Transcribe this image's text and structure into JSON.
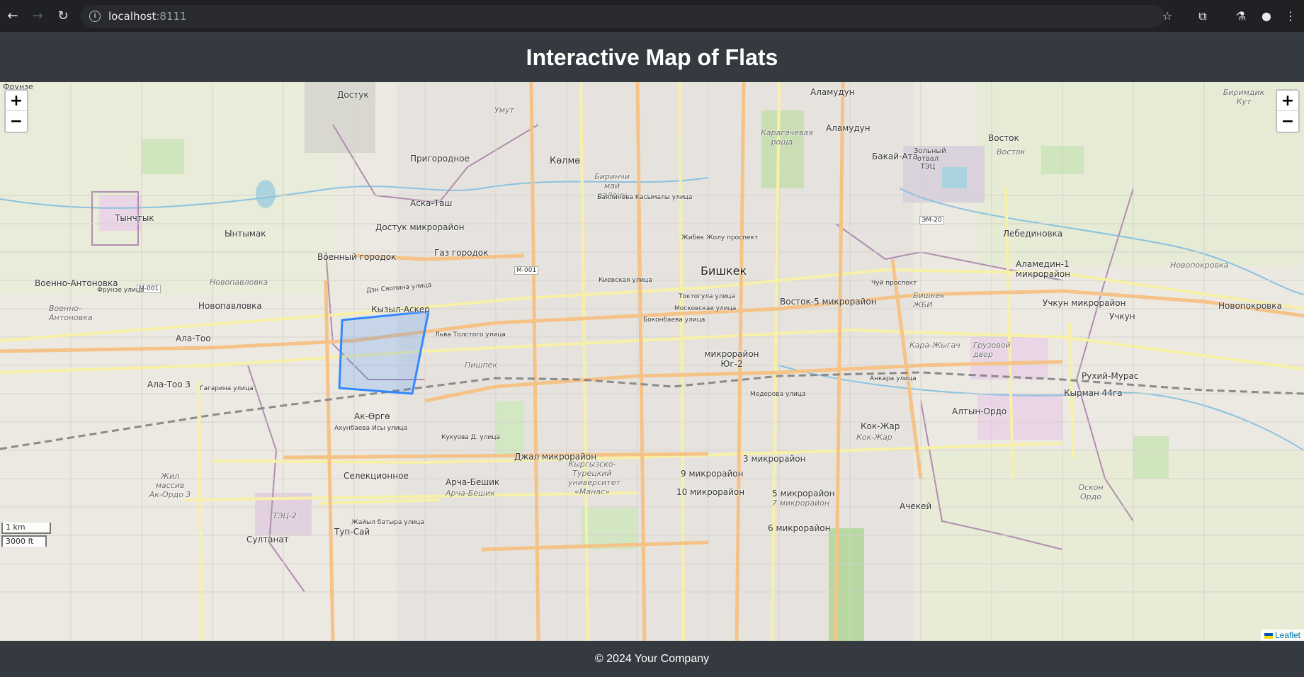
{
  "browser": {
    "url_host": "localhost",
    "url_port": ":8111"
  },
  "header": {
    "title": "Interactive Map of Flats"
  },
  "map": {
    "zoom_in_label": "+",
    "zoom_out_label": "−",
    "scale_km": "1 km",
    "scale_ft": "3000 ft",
    "attribution": "Leaflet",
    "polygon_color": "#3388ff",
    "labels": {
      "frunze": "Фрунзе",
      "dostuk": "Достук",
      "umut": "Умут",
      "alamudun_top": "Аламудун",
      "alamudun": "Аламудун",
      "birimdik_kut": "Биримдик Кут",
      "prigorodnoe": "Пригородное",
      "kolmo": "Кѳлмѳ",
      "karagachevaya_roshcha": "Карагачевая роща",
      "vostok": "Восток",
      "vostok_italic": "Восток",
      "bakai_ata": "Бакай-Ата",
      "zoly_otval": "Зольный отвал ТЭЦ",
      "birinchi": "Биринчи май району",
      "tynchtyk": "Тынчтык",
      "intymak": "Ынтымак",
      "aska_tash": "Аска-Таш",
      "dostuk_mkr": "Достук микрорайон",
      "lebedinovka": "Лебединовка",
      "voenny_gorodok": "Военный городок",
      "gaz_gorodok": "Газ городок",
      "bishkek": "Бишкек",
      "alamedin_1": "Аламедин-1 микрорайон",
      "novopokrovka_italic": "Новопокровка",
      "voenno_antonovka": "Военно-Антоновка",
      "novopavlovka_italic": "Новопавловка",
      "kyzyl_asker": "Кызыл-Аскер",
      "vostok_5": "Восток-5 микрорайон",
      "uchkun_mkr": "Учкун микрорайон",
      "novopokrovka": "Новопокровка",
      "voenno_antonovka_italic": "Военно-Антоновка",
      "novopavlovka": "Новопавловка",
      "bishkek_zhbi": "Бишкек ЖБИ",
      "uchkun": "Учкун",
      "ala_too": "Ала-Тоо",
      "kara_zhygach": "Кара-Жыгач",
      "gruzovoy_dvor": "Грузовой двор",
      "mkr_yug_2": "микрорайон Юг-2",
      "pishpek": "Пишпек",
      "rukhiy_muras": "Рухий-Мурас",
      "ala_too_3": "Ала-Тоо 3",
      "kyrman": "Кырман 44га",
      "altyn_ordo": "Алтын-Ордо",
      "ak_orgo": "Ак-Ѳргѳ",
      "kok_zhar": "Кок-Жар",
      "kok_zhar_italic": "Кок-Жар",
      "dzhal": "Джал микрорайон",
      "mkr_3": "3 микрорайон",
      "kyrgyz_turkish": "Кыргызско-Турецкий университет «Манас»",
      "selektsionnoe": "Селекционное",
      "mkr_9": "9 микрорайон",
      "zhil_massiv": "Жил массив Ак-Ордо 3",
      "archa_beshik": "Арча-Бешик",
      "archa_beshik_italic": "Арча-Бешик",
      "mkr_10": "10 микрорайон",
      "mkr_5": "5 микрорайон",
      "mkr_7": "7 микрорайон",
      "oskon_ordo": "Оскон Ордо",
      "achekei": "Ачекей",
      "tets_2": "ТЭЦ-2",
      "tup_sai": "Туп-Сай",
      "mkr_6": "6 микрорайон",
      "sultanat": "Султанат",
      "road_m001_w": "М-001",
      "road_m001_c": "М-001",
      "road_em20": "ЭМ-20",
      "street_frunze": "Фрунзе улица",
      "street_zhibek_zholu": "Жибек Жолу проспект",
      "street_chui": "Чуй проспект",
      "street_kievskaya": "Киевская улица",
      "street_toktogul": "Токтогула улица",
      "street_moskovskaya": "Московская улица",
      "street_bokonbaeva": "Боконбаева улица",
      "street_gagarina": "Гагарина улица",
      "street_ankara": "Анкара улица",
      "street_mederova": "Медерова улица",
      "street_kukuova": "Кукуова Д. улица",
      "street_akhunbaeva": "Ахунбаева Исы улица",
      "street_zhaiyl": "Жайыл батыра улица",
      "street_l_tolstogo": "Льва Толстого улица",
      "street_den_syaopina": "Дэн Сяопина улица",
      "street_bayalinova": "Баялинова Касымалы улица"
    }
  },
  "footer": {
    "text": "© 2024 Your Company"
  }
}
